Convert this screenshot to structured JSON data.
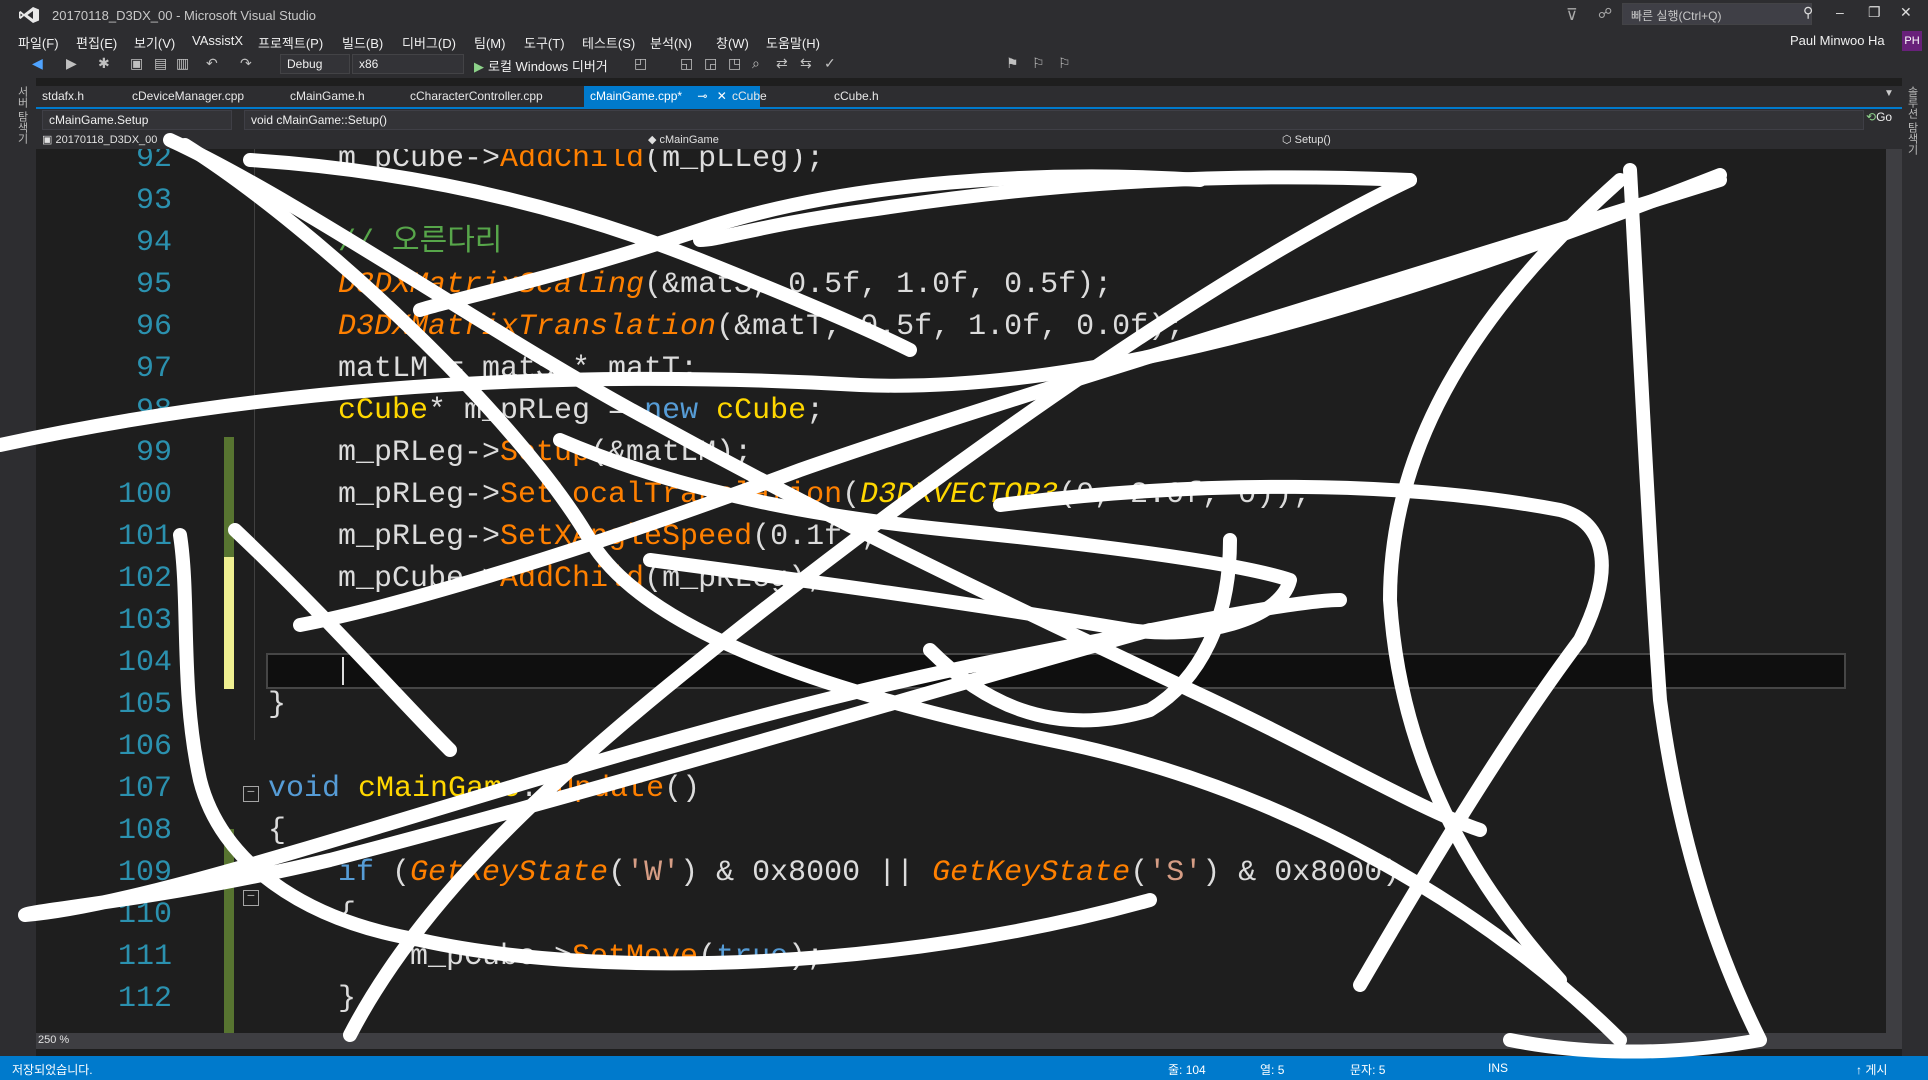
{
  "window": {
    "title": "20170118_D3DX_00 - Microsoft Visual Studio",
    "quick_launch_placeholder": "빠른 실행(Ctrl+Q)",
    "user": "Paul Minwoo Ha",
    "avatar": "PH"
  },
  "menu": [
    "파일(F)",
    "편집(E)",
    "보기(V)",
    "VAssistX",
    "프로젝트(P)",
    "빌드(B)",
    "디버그(D)",
    "팀(M)",
    "도구(T)",
    "테스트(S)",
    "분석(N)",
    "창(W)",
    "도움말(H)"
  ],
  "toolbar": {
    "config": "Debug",
    "platform": "x86",
    "run_label": "로컬 Windows 디버거"
  },
  "left_strip_label": "서버 탐색기",
  "right_strip_label": "솔루션 탐색기",
  "tabs": [
    {
      "label": "stdafx.h"
    },
    {
      "label": "cDeviceManager.cpp"
    },
    {
      "label": "cMainGame.h"
    },
    {
      "label": "cCharacterController.cpp"
    },
    {
      "label": "cMainGame.cpp*"
    },
    {
      "label": "cCube"
    },
    {
      "label": "cCube.h"
    }
  ],
  "nav": {
    "scope": "cMainGame.Setup",
    "function": "void cMainGame::Setup()",
    "go": "Go"
  },
  "nav2": {
    "project": "20170118_D3DX_00",
    "class": "cMainGame",
    "member": "Setup()"
  },
  "code": {
    "lines": [
      {
        "num": "92",
        "text": "m_pCube->AddChild(m_pLLeg);"
      },
      {
        "num": "93",
        "text": ""
      },
      {
        "num": "94",
        "text": "// 오른다리"
      },
      {
        "num": "95",
        "text": "D3DXMatrixScaling(&matS, 0.5f, 1.0f, 0.5f);"
      },
      {
        "num": "96",
        "text": "D3DXMatrixTranslation(&matT, 0.5f, 1.0f, 0.0f);"
      },
      {
        "num": "97",
        "text": "matLM = matS * matT;"
      },
      {
        "num": "98",
        "text": "cCube* m_pRLeg = new cCube;"
      },
      {
        "num": "99",
        "text": "m_pRLeg->Setup(&matLM);"
      },
      {
        "num": "100",
        "text": "m_pRLeg->SetLocalTranslation(D3DXVECTOR3(0, 2.0f, 0));"
      },
      {
        "num": "101",
        "text": "m_pRLeg->SetXAngleSpeed(0.1f);"
      },
      {
        "num": "102",
        "text": "m_pCube->AddChild(m_pRLeg);"
      },
      {
        "num": "103",
        "text": ""
      },
      {
        "num": "104",
        "text": ""
      },
      {
        "num": "105",
        "text": "}"
      },
      {
        "num": "106",
        "text": ""
      },
      {
        "num": "107",
        "text": "void cMainGame::Update()"
      },
      {
        "num": "108",
        "text": "{"
      },
      {
        "num": "109",
        "text": "if (GetKeyState('W') & 0x8000 || GetKeyState('S') & 0x8000)"
      },
      {
        "num": "110",
        "text": "{"
      },
      {
        "num": "111",
        "text": "m_pCube->SetMove(true);"
      },
      {
        "num": "112",
        "text": "}"
      }
    ]
  },
  "zoom": "250 %",
  "status": {
    "message": "저장되었습니다.",
    "line": "줄: 104",
    "col": "열: 5",
    "char": "문자: 5",
    "mode": "INS",
    "publish": "게시"
  },
  "colors": {
    "accent": "#007acc",
    "editor_bg": "#1e1e1e",
    "chrome_bg": "#2d2d30",
    "line_number": "#2b91af",
    "keyword": "#569cd6",
    "function": "#ff8000",
    "comment": "#57a64a",
    "macro_type": "#ffd700"
  }
}
